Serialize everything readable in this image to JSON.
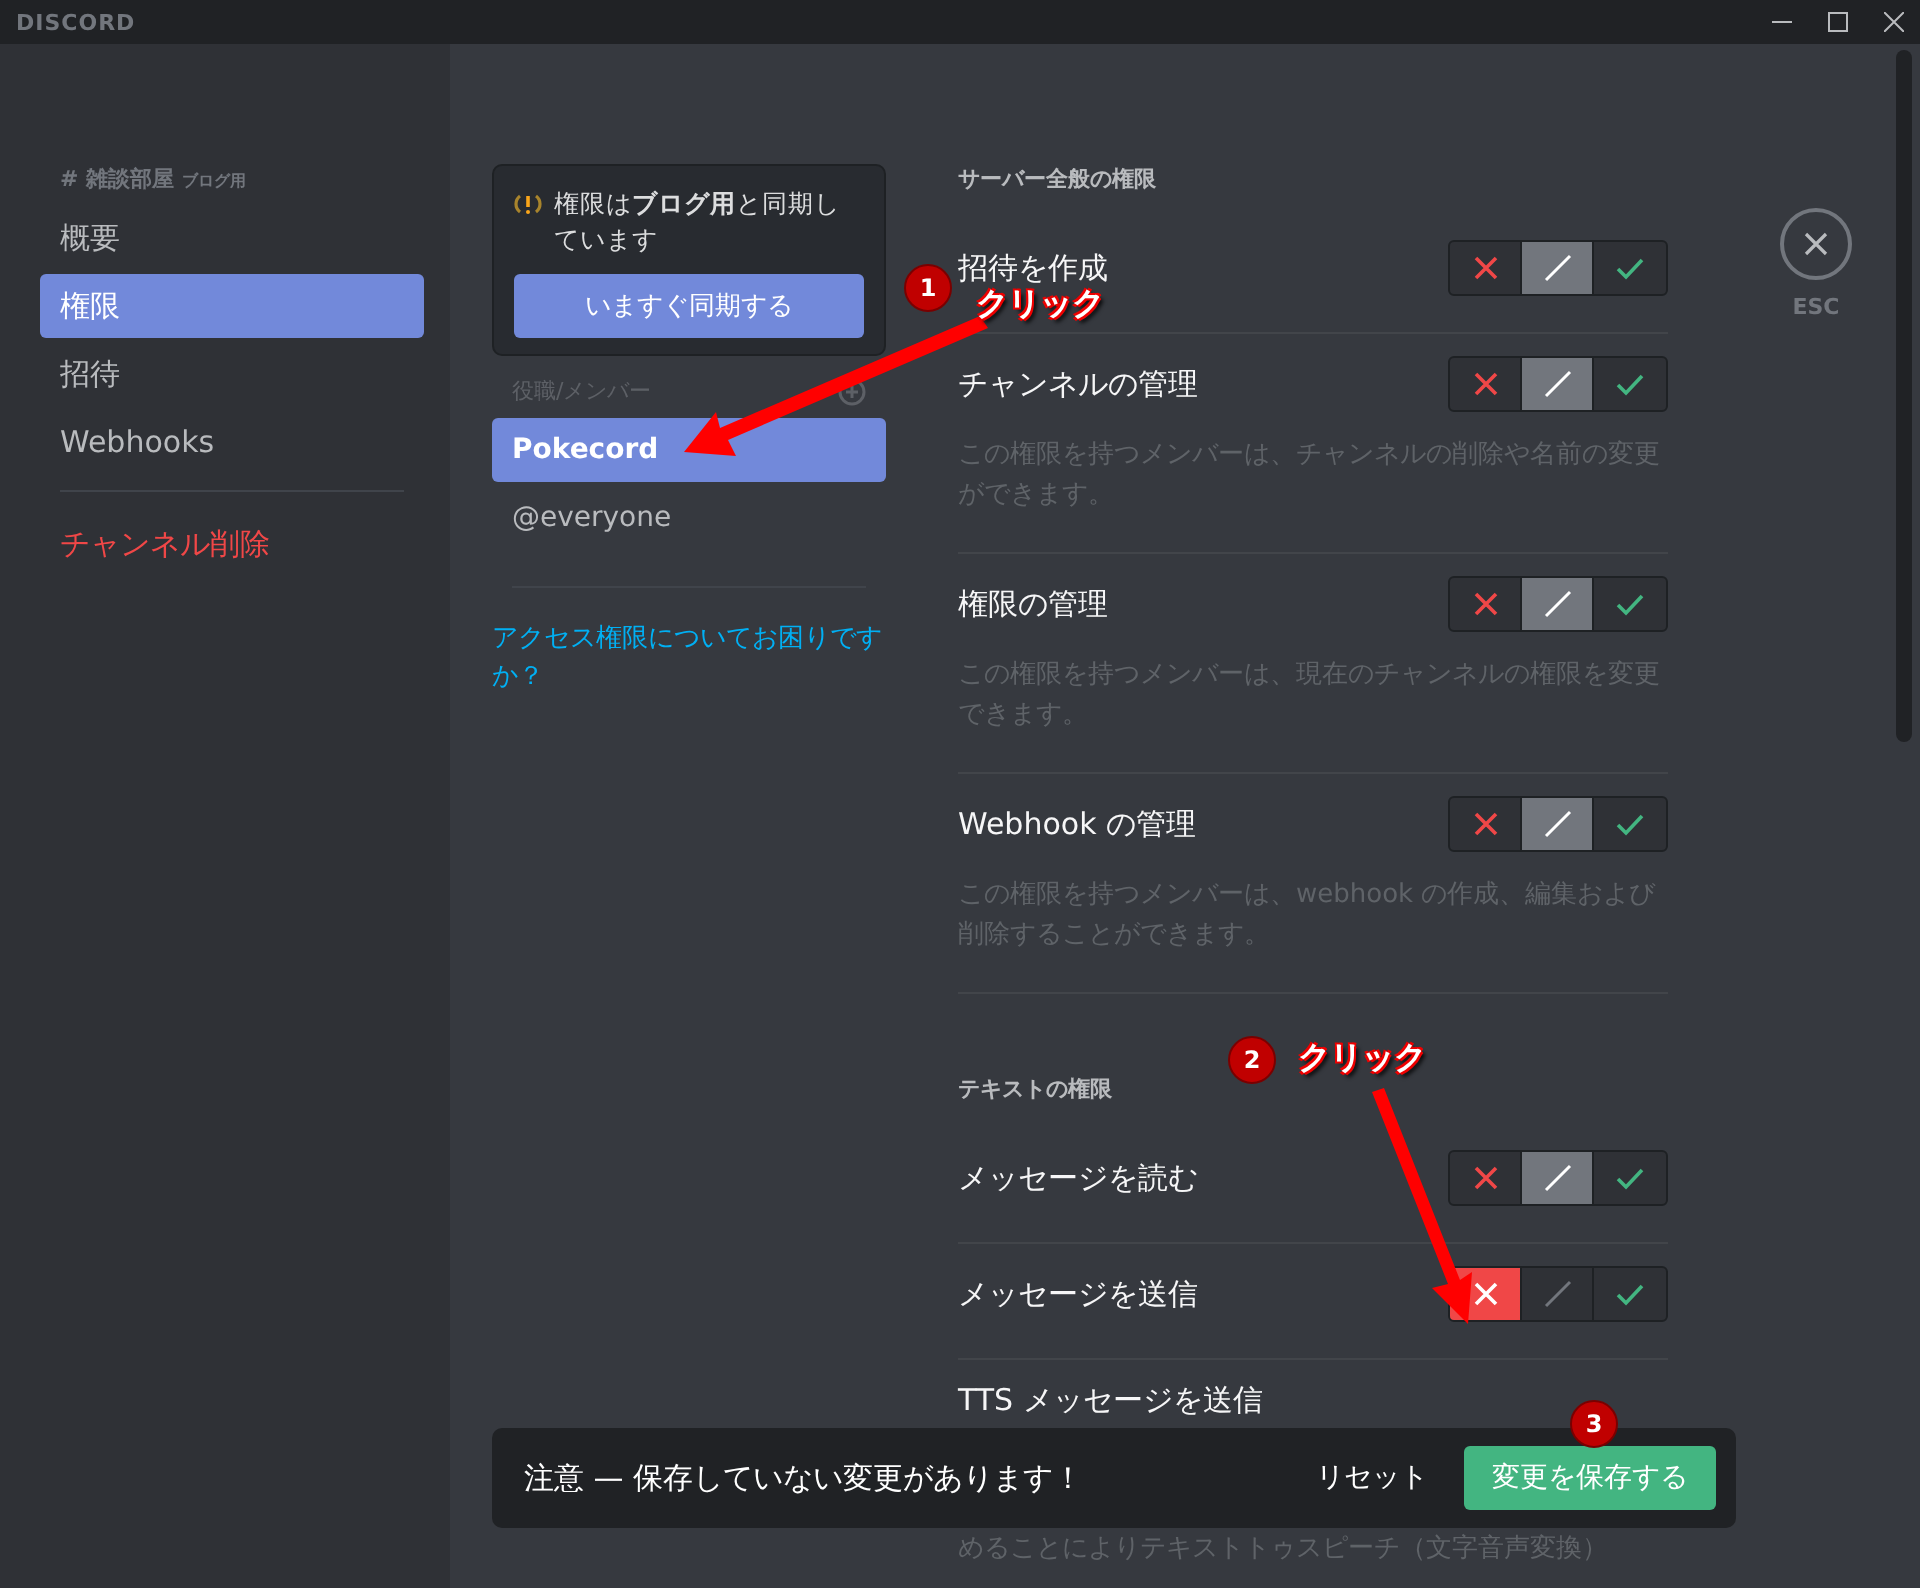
{
  "window": {
    "title": "DISCORD"
  },
  "sidebar": {
    "channel": "# 雑談部屋",
    "category": "ブログ用",
    "items": [
      {
        "label": "概要",
        "selected": false
      },
      {
        "label": "権限",
        "selected": true
      },
      {
        "label": "招待",
        "selected": false
      },
      {
        "label": "Webhooks",
        "selected": false
      }
    ],
    "danger_item": "チャンネル削除"
  },
  "sync_notice": {
    "text": "権限は**ブログ用**と同期しています",
    "button": "いますぐ同期する"
  },
  "roles": {
    "heading": "役職/メンバー",
    "items": [
      {
        "label": "Pokecord",
        "selected": true
      },
      {
        "label": "@everyone",
        "selected": false
      }
    ],
    "help_link": "アクセス権限についてお困りですか？"
  },
  "permissions": {
    "sections": [
      {
        "heading": "サーバー全般の権限",
        "items": [
          {
            "title": "招待を作成",
            "denied": false,
            "allowed": false
          },
          {
            "title": "チャンネルの管理",
            "description": "この権限を持つメンバーは、チャンネルの削除や名前の変更ができます。",
            "denied": false,
            "allowed": false
          },
          {
            "title": "権限の管理",
            "description": "この権限を持つメンバーは、現在のチャンネルの権限を変更できます。",
            "denied": false,
            "allowed": false
          },
          {
            "title": "Webhook の管理",
            "description": "この権限を持つメンバーは、webhook の作成、編集および削除することができます。",
            "denied": false,
            "allowed": false
          }
        ]
      },
      {
        "heading": "テキストの権限",
        "items": [
          {
            "title": "メッセージを読む",
            "denied": false,
            "allowed": false
          },
          {
            "title": "メッセージを送信",
            "denied": true,
            "allowed": false
          },
          {
            "title": "TTS メッセージを送信",
            "description": "めることによりテキストトゥスピーチ（文字音声変換）"
          }
        ]
      }
    ]
  },
  "close": {
    "label": "ESC"
  },
  "notice_bar": {
    "message": "注意 — 保存していない変更があります！",
    "reset": "リセット",
    "save": "変更を保存する"
  },
  "annotations": [
    {
      "number": "1",
      "label": "クリック"
    },
    {
      "number": "2",
      "label": "クリック"
    },
    {
      "number": "3"
    }
  ]
}
